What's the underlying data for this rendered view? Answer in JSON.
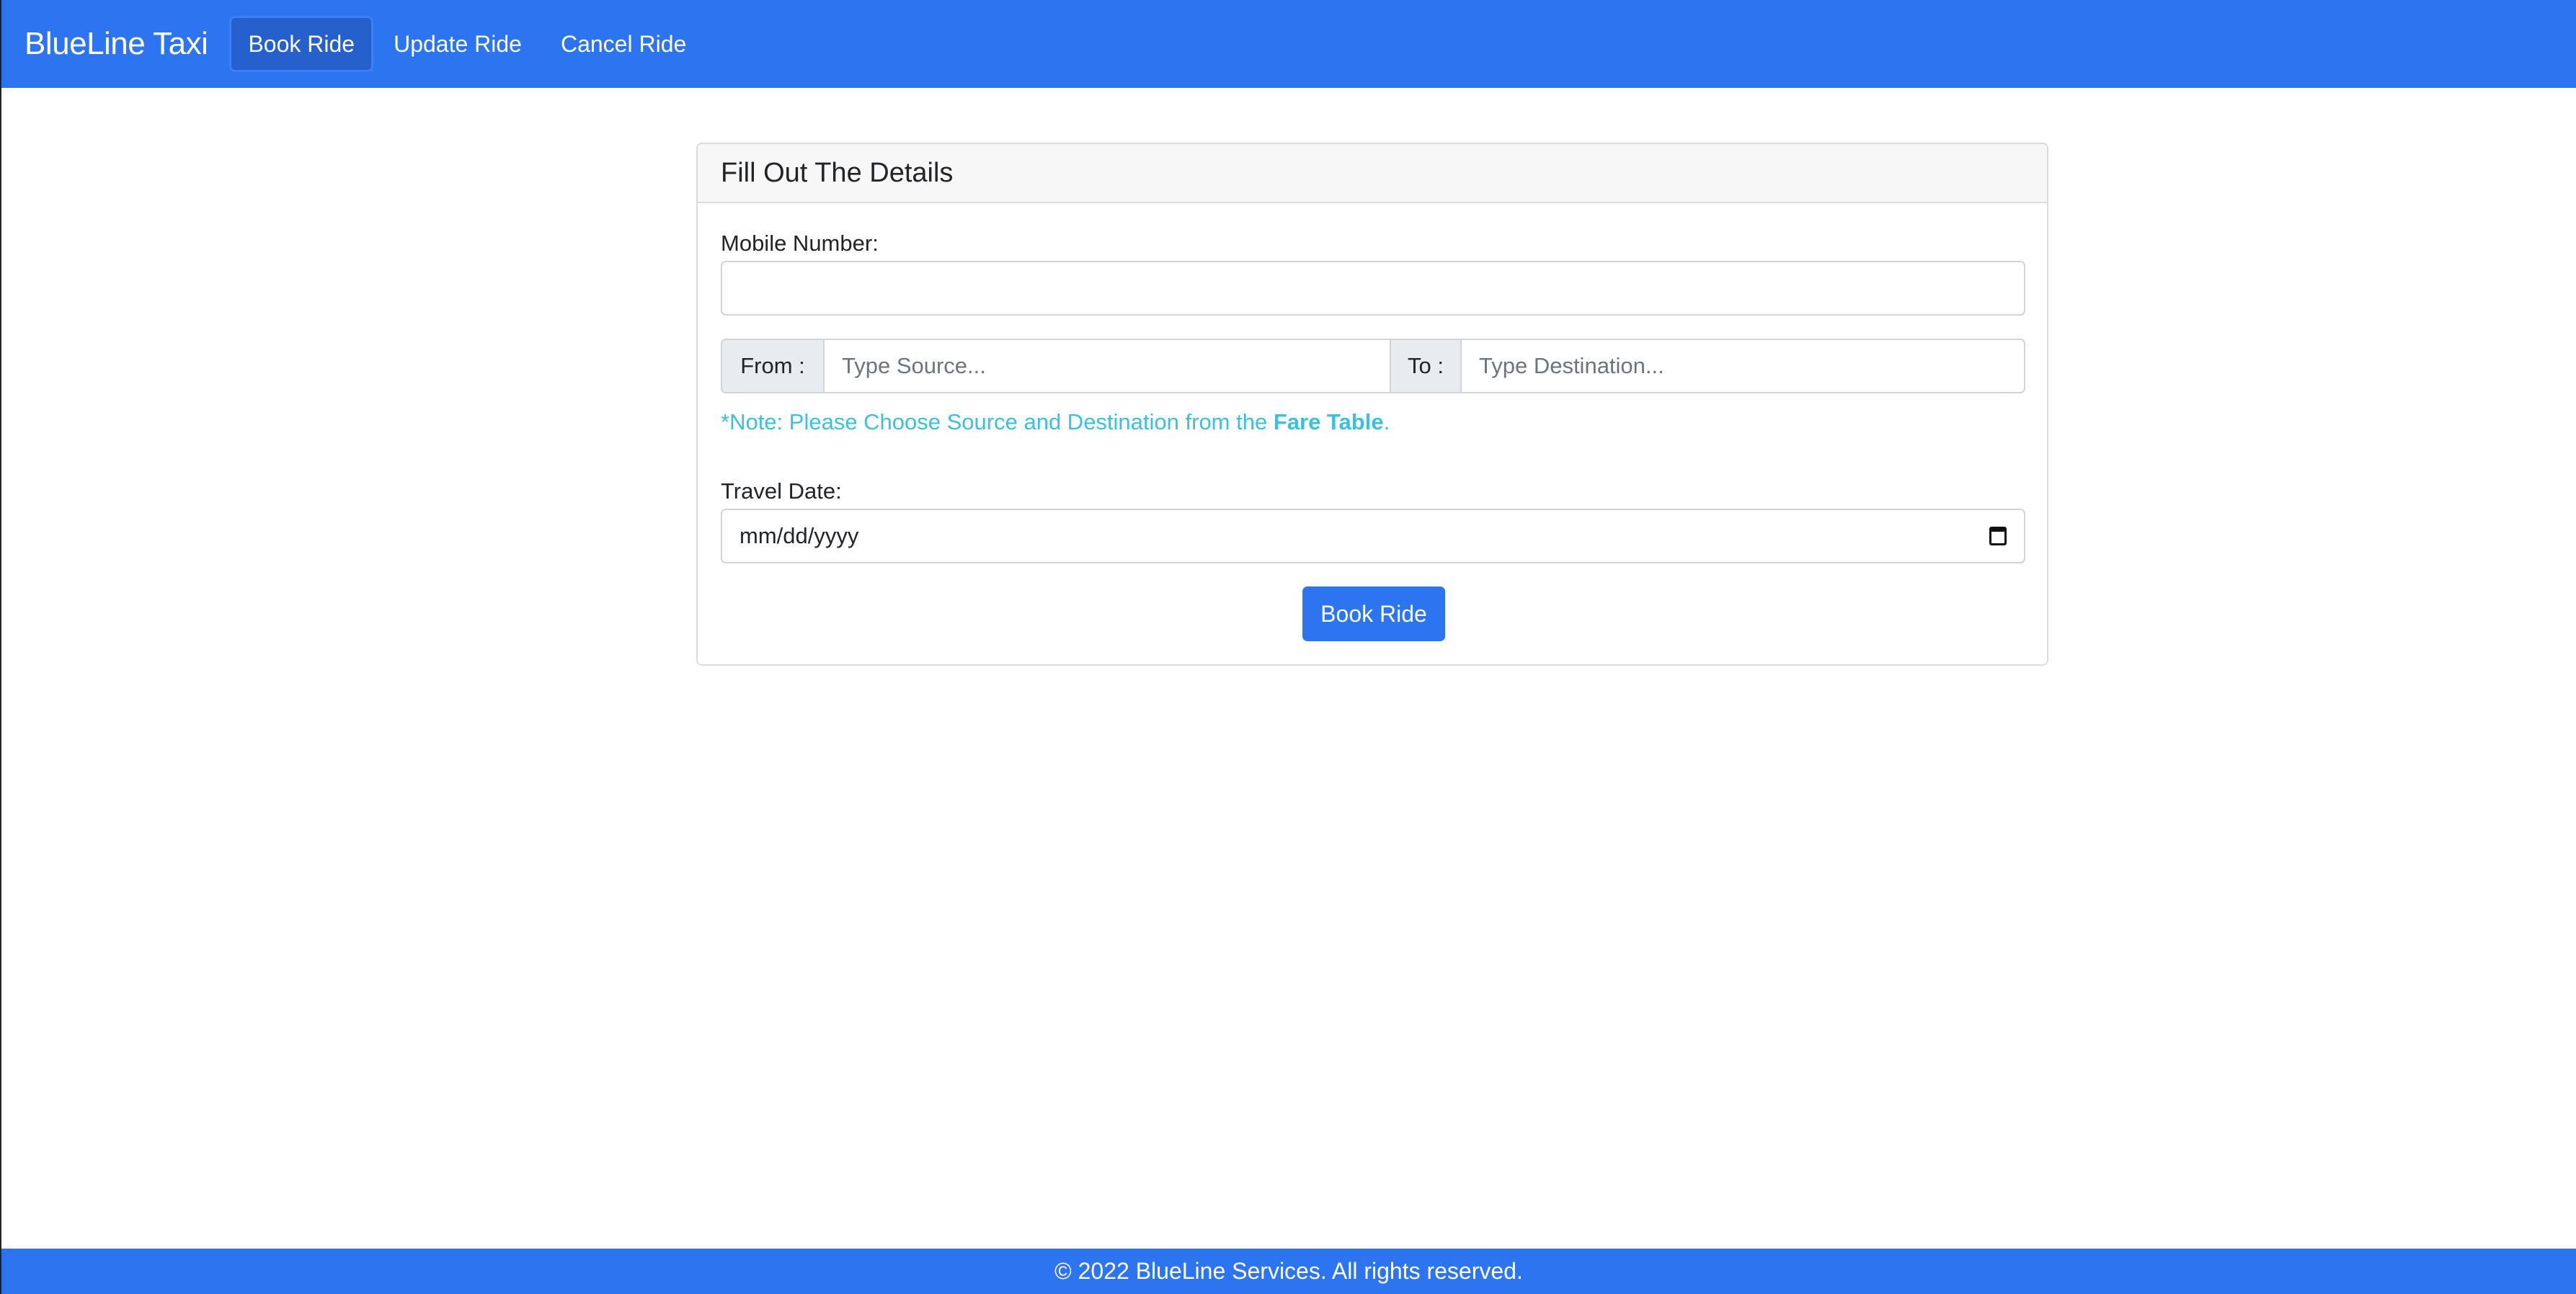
{
  "navbar": {
    "brand": "BlueLine Taxi",
    "links": [
      {
        "label": "Book Ride",
        "active": true
      },
      {
        "label": "Update Ride",
        "active": false
      },
      {
        "label": "Cancel Ride",
        "active": false
      }
    ]
  },
  "form": {
    "title": "Fill Out The Details",
    "mobile_label": "Mobile Number:",
    "mobile_value": "",
    "from_label": "From :",
    "from_placeholder": "Type Source...",
    "to_label": "To :",
    "to_placeholder": "Type Destination...",
    "note_prefix": "*Note: Please Choose Source and Destination from the ",
    "note_link": "Fare Table",
    "note_suffix": ".",
    "date_label": "Travel Date:",
    "date_value": "mm/dd/yyyy",
    "submit_label": "Book Ride"
  },
  "footer": {
    "text": "© 2022 BlueLine Services. All rights reserved."
  },
  "colors": {
    "primary": "#2d74f0",
    "note": "#3cc0e0"
  }
}
